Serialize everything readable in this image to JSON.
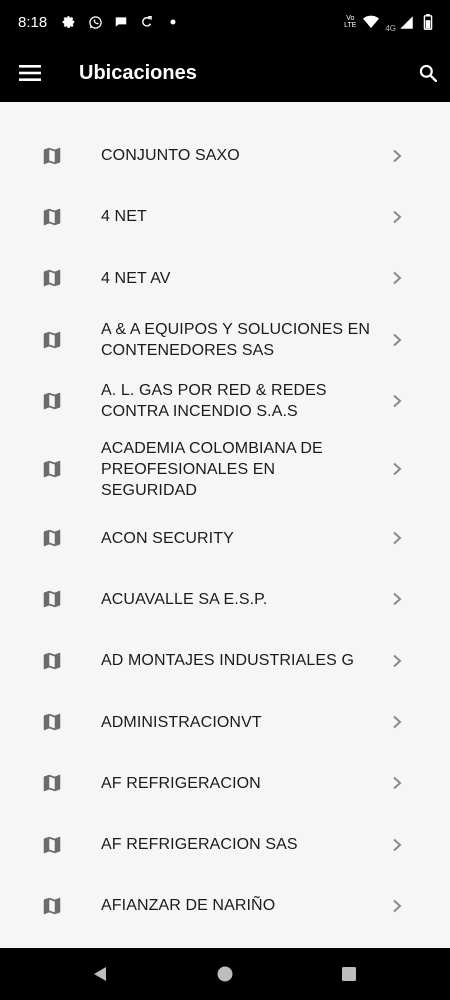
{
  "status_bar": {
    "time": "8:18",
    "left_icons": [
      "gear-icon",
      "whatsapp-icon",
      "chat-bubble-icon",
      "sync-icon",
      "dot-icon"
    ],
    "lte_label": "Vo LTE",
    "network_label": "4G",
    "right_icons": [
      "wifi-icon",
      "signal-icon",
      "battery-icon"
    ]
  },
  "app_bar": {
    "title": "Ubicaciones",
    "menu_icon": "hamburger-menu-icon",
    "search_icon": "search-icon"
  },
  "locations": [
    {
      "name": " CONJUNTO SAXO"
    },
    {
      "name": "4 NET"
    },
    {
      "name": "4 NET AV"
    },
    {
      "name": "A & A EQUIPOS Y SOLUCIONES EN CONTENEDORES SAS"
    },
    {
      "name": "A. L. GAS POR RED & REDES CONTRA INCENDIO S.A.S"
    },
    {
      "name": "ACADEMIA COLOMBIANA DE PREOFESIONALES EN SEGURIDAD"
    },
    {
      "name": "ACON SECURITY"
    },
    {
      "name": "ACUAVALLE SA E.S.P."
    },
    {
      "name": "AD MONTAJES INDUSTRIALES G"
    },
    {
      "name": "ADMINISTRACIONVT"
    },
    {
      "name": "AF REFRIGERACION"
    },
    {
      "name": "AF REFRIGERACION SAS"
    },
    {
      "name": "AFIANZAR DE NARIÑO"
    }
  ],
  "row_icons": {
    "leading": "map-icon",
    "trailing": "chevron-right-icon"
  },
  "nav_bar": {
    "icons": [
      "back-icon",
      "home-icon",
      "recents-icon"
    ]
  },
  "colors": {
    "bar": "#000000",
    "background": "#f6f6f7",
    "text": "#1b1b1b",
    "icon": "#6b6b6b",
    "chevron": "#8a8a8a"
  }
}
